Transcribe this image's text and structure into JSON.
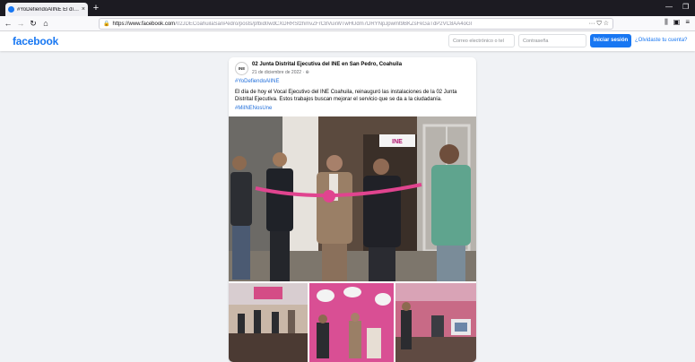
{
  "browser": {
    "tab_title": "#YoDefiendoAlINE El día de ho",
    "tab_close": "×",
    "new_tab": "+",
    "url_host": "https://www.facebook.com",
    "url_rest": "/02JDECoahuilaSanPedro/posts/pfbid0wdCXDRRStzhmvZFrC8VuxWTwHUdm7DRYNpJpwmt9BKZsFkGaTdP2VC8AA4oGl",
    "zoom_actions": "··· ⛉ ☆"
  },
  "facebook": {
    "logo": "facebook",
    "email_placeholder": "Correo electrónico o tel",
    "password_placeholder": "Contraseña",
    "login_label": "Iniciar sesión",
    "forgot_label": "¿Olvidaste tu cuenta?"
  },
  "post": {
    "avatar_text": "INE",
    "author": "02 Junta Distrital Ejecutiva del INE en San Pedro, Coahuila",
    "date": "21 de diciembre de 2022 · ⊕",
    "hashtag_top": "#YoDefiendoAlINE",
    "body": "El día de hoy el Vocal Ejecutivo del INE Coahuila, reinauguró las instalaciones de la 02 Junta Distrital Ejecutiva. Estos trabajos buscan mejorar el servicio que se da a la ciudadanía.",
    "hashtag_bottom": "#MiINENosUne",
    "photo_sign": "INE"
  }
}
